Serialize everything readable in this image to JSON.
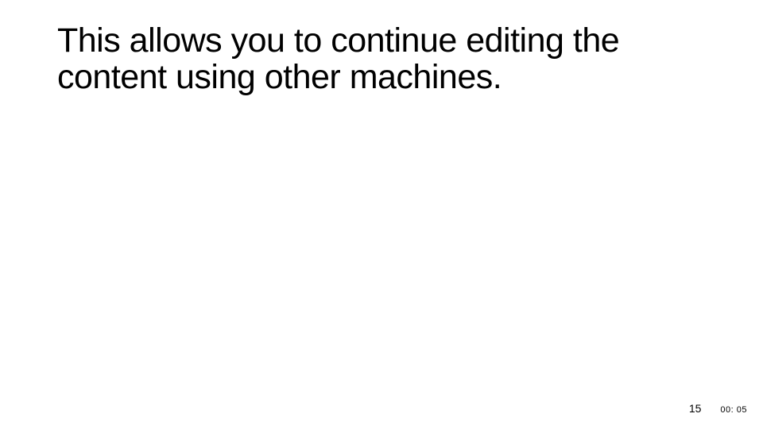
{
  "slide": {
    "title": "This allows you to continue editing the content using other machines."
  },
  "footer": {
    "page_number": "15",
    "timer": "00: 05"
  }
}
